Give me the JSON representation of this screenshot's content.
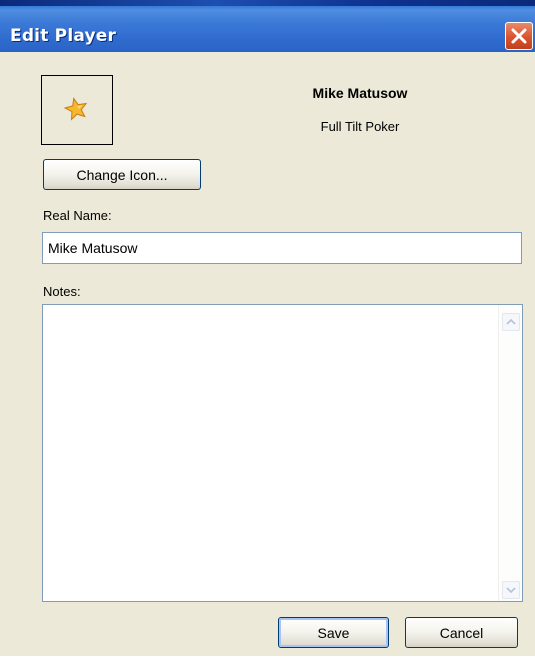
{
  "window": {
    "title": "Edit Player",
    "close_icon": "close-icon"
  },
  "player": {
    "icon": "star-icon",
    "name": "Mike Matusow",
    "site": "Full Tilt Poker"
  },
  "buttons": {
    "change_icon": "Change Icon...",
    "save": "Save",
    "cancel": "Cancel"
  },
  "fields": {
    "real_name_label": "Real Name:",
    "real_name_value": "Mike Matusow",
    "notes_label": "Notes:",
    "notes_value": ""
  },
  "colors": {
    "titlebar": "#2f6bce",
    "close_button": "#d9542f",
    "dialog_background": "#ece9d8",
    "star": "#f5b82e"
  }
}
